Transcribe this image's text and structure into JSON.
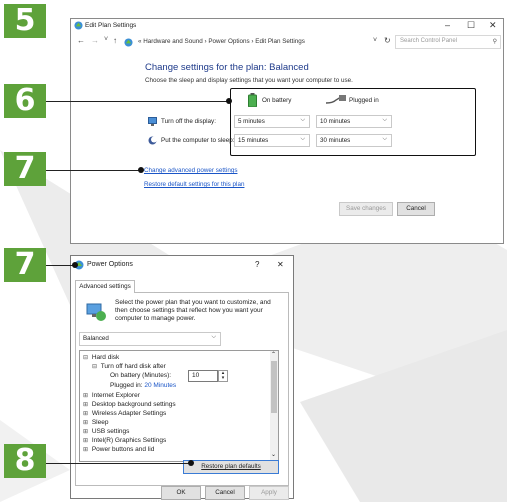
{
  "badges": {
    "b5": "5",
    "b6": "6",
    "b7a": "7",
    "b7b": "7",
    "b8": "8"
  },
  "window1": {
    "title": "Edit Plan Settings",
    "controls": {
      "minimize": "–",
      "maximize": "☐",
      "close": "✕"
    },
    "nav": {
      "back": "←",
      "forward": "→",
      "up": "↑",
      "history": "˅"
    },
    "address": "« Hardware and Sound  ›  Power Options  ›  Edit Plan Settings",
    "address_dropdown": "˅",
    "refresh": "↻",
    "search_placeholder": "Search Control Panel",
    "heading": "Change settings for the plan: Balanced",
    "subheading": "Choose the sleep and display settings that you want your computer to use.",
    "col_battery": "On battery",
    "col_plugged": "Plugged in",
    "row_display_label": "Turn off the display:",
    "row_display_battery": "5 minutes",
    "row_display_plugged": "10 minutes",
    "row_sleep_label": "Put the computer to sleep:",
    "row_sleep_battery": "15 minutes",
    "row_sleep_plugged": "30 minutes",
    "link_advanced": "Change advanced power settings",
    "link_restore": "Restore default settings for this plan",
    "btn_save": "Save changes",
    "btn_cancel": "Cancel"
  },
  "window2": {
    "title": "Power Options",
    "help": "?",
    "close": "✕",
    "tab": "Advanced settings",
    "description": "Select the power plan that you want to customize, and then choose settings that reflect how you want your computer to manage power.",
    "plan_select": "Balanced",
    "tree": {
      "hard_disk": "Hard disk",
      "turn_off_hd": "Turn off hard disk after",
      "on_battery_label": "On battery (Minutes):",
      "on_battery_value": "10",
      "plugged_in_label": "Plugged in:",
      "plugged_in_value": "20 Minutes",
      "ie": "Internet Explorer",
      "desktop_bg": "Desktop background settings",
      "wireless": "Wireless Adapter Settings",
      "sleep": "Sleep",
      "usb": "USB settings",
      "intel_graphics": "Intel(R) Graphics Settings",
      "power_buttons": "Power buttons and lid"
    },
    "btn_restore": "Restore plan defaults",
    "btn_ok": "OK",
    "btn_cancel": "Cancel",
    "btn_apply": "Apply"
  },
  "colors": {
    "badge": "#5ea23a",
    "link": "#1a55c7",
    "heading": "#1e3a8a"
  }
}
